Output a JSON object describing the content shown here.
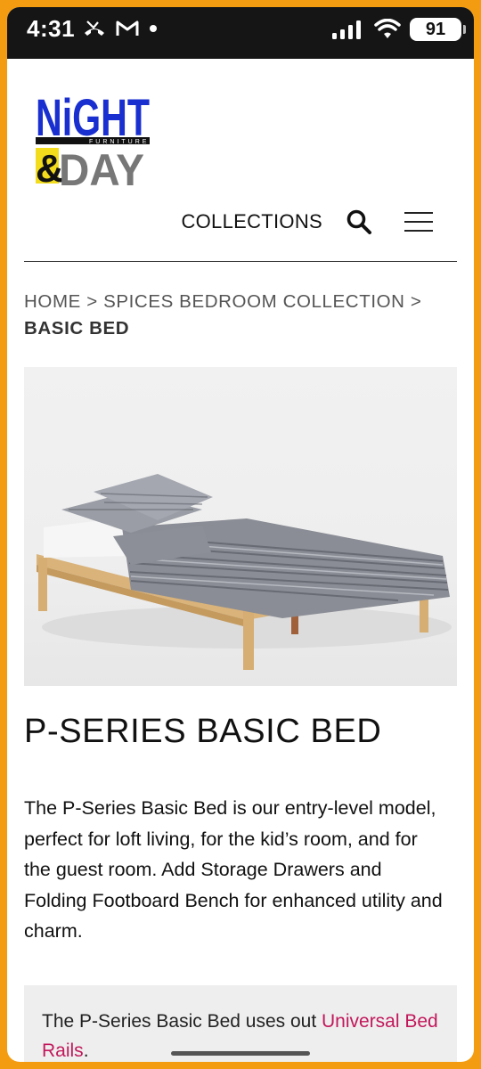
{
  "status_bar": {
    "time": "4:31",
    "battery": "91",
    "icons": [
      "missed-call-icon",
      "gmail-icon",
      "dot-icon",
      "signal-icon",
      "wifi-icon",
      "battery-icon"
    ]
  },
  "header": {
    "logo_text_top": "NiGHT",
    "logo_text_sub": "FURNITURE",
    "logo_text_bottom": "DAY",
    "logo_amp": "&",
    "nav_collections": "COLLECTIONS"
  },
  "breadcrumb": {
    "home": "HOME",
    "separator": ">",
    "collection": "SPICES BEDROOM COLLECTION",
    "current": "BASIC BED"
  },
  "product": {
    "title": "P-SERIES BASIC BED",
    "description": "The P-Series Basic Bed is our entry-level model, perfect for loft living, for the kid’s room, and for the guest room. Add Storage Drawers and Folding Footboard Bench for enhanced utility and charm.",
    "note_prefix": "The P-Series Basic Bed uses out ",
    "note_link": "Universal Bed Rails",
    "note_suffix": "."
  },
  "colors": {
    "frame": "#f39c12",
    "logo_blue": "#1a2fd0",
    "logo_yellow": "#f2dc1c",
    "link": "#c2185b"
  }
}
